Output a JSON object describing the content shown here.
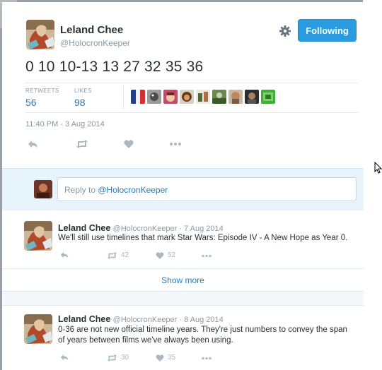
{
  "main_tweet": {
    "name": "Leland Chee",
    "handle": "@HolocronKeeper",
    "follow_label": "Following",
    "text": "0 10 10-13 13 27 32 35 36",
    "retweets_label": "RETWEETS",
    "retweets_value": "56",
    "likes_label": "LIKES",
    "likes_value": "98",
    "timestamp": "11:40 PM - 3 Aug 2014"
  },
  "reply_box": {
    "prefix": "Reply to ",
    "mention": "@HolocronKeeper"
  },
  "replies": [
    {
      "name": "Leland Chee",
      "meta": "@HolocronKeeper · 7 Aug 2014",
      "text": "We'll still use timelines that mark Star Wars: Episode IV - A New Hope as Year 0.",
      "retweets": "42",
      "likes": "52"
    },
    {
      "name": "Leland Chee",
      "meta": "@HolocronKeeper · 8 Aug 2014",
      "text": "0-36 are not new official timeline years. They're just numbers to convey the span of years between films we've always been using.",
      "retweets": "30",
      "likes": "35"
    }
  ],
  "show_more": "Show more",
  "colors": {
    "accent": "#2b9bdf",
    "link": "#2b7bb9",
    "muted": "#8899a6",
    "reply_bg": "#e8f4fb"
  }
}
